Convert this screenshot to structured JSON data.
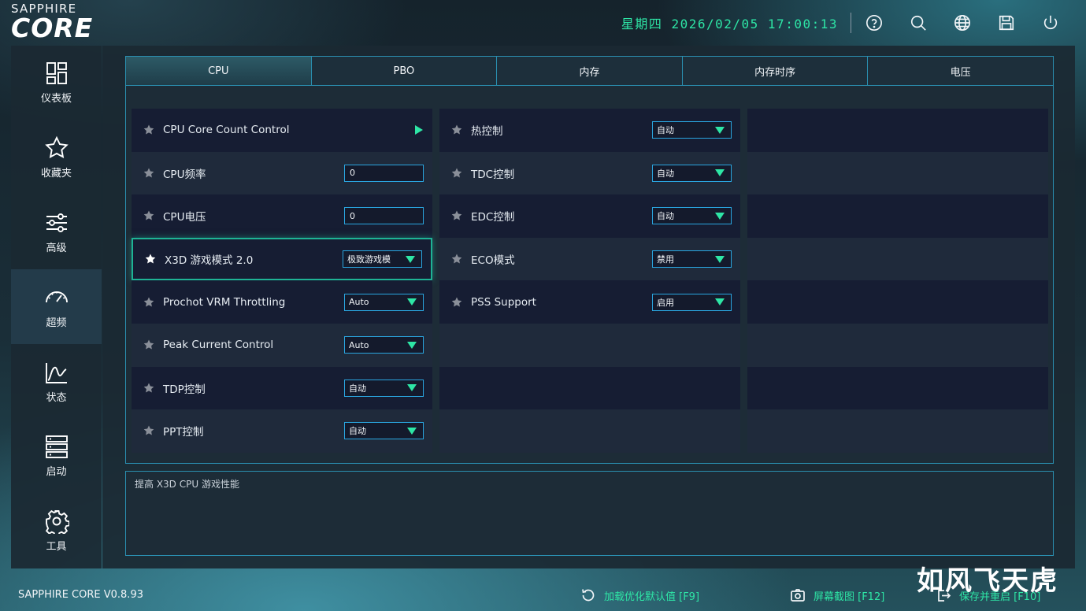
{
  "brand": {
    "top": "SAPPHIRE",
    "main": "CORE"
  },
  "header": {
    "datetime": "星期四 2026/02/05 17:00:13",
    "icons": [
      "help-icon",
      "search-icon",
      "globe-icon",
      "save-icon",
      "power-icon"
    ]
  },
  "sidebar": {
    "items": [
      {
        "label": "仪表板",
        "icon": "dashboard-icon"
      },
      {
        "label": "收藏夹",
        "icon": "star-icon"
      },
      {
        "label": "高级",
        "icon": "sliders-icon"
      },
      {
        "label": "超频",
        "icon": "gauge-icon",
        "active": true
      },
      {
        "label": "状态",
        "icon": "chart-icon"
      },
      {
        "label": "启动",
        "icon": "boot-icon"
      },
      {
        "label": "工具",
        "icon": "gear-icon"
      }
    ]
  },
  "tabs": [
    {
      "label": "CPU",
      "active": true
    },
    {
      "label": "PBO"
    },
    {
      "label": "内存"
    },
    {
      "label": "内存时序"
    },
    {
      "label": "电压"
    }
  ],
  "settings": {
    "col1": [
      {
        "label": "CPU Core Count Control",
        "type": "submenu"
      },
      {
        "label": "CPU频率",
        "type": "input",
        "value": "0"
      },
      {
        "label": "CPU电压",
        "type": "input",
        "value": "0"
      },
      {
        "label": "X3D 游戏模式 2.0",
        "type": "select",
        "value": "极致游戏模",
        "selected": true
      },
      {
        "label": "Prochot VRM Throttling",
        "type": "select",
        "value": "Auto"
      },
      {
        "label": "Peak Current Control",
        "type": "select",
        "value": "Auto"
      },
      {
        "label": "TDP控制",
        "type": "select",
        "value": "自动"
      },
      {
        "label": "PPT控制",
        "type": "select",
        "value": "自动"
      }
    ],
    "col2": [
      {
        "label": "热控制",
        "type": "select",
        "value": "自动"
      },
      {
        "label": "TDC控制",
        "type": "select",
        "value": "自动"
      },
      {
        "label": "EDC控制",
        "type": "select",
        "value": "自动"
      },
      {
        "label": "ECO模式",
        "type": "select",
        "value": "禁用"
      },
      {
        "label": "PSS Support",
        "type": "select",
        "value": "启用"
      }
    ]
  },
  "description": "提高 X3D CPU 游戏性能",
  "footer": {
    "version": "SAPPHIRE CORE V0.8.93",
    "load_defaults": "加载优化默认值 [F9]",
    "screenshot": "屏幕截图 [F12]",
    "save_restart": "保存并重启 [F10]"
  },
  "watermark": "如风飞天虎",
  "colors": {
    "accent": "#2ee6a6",
    "border": "#2a8fb0",
    "panel": "#1b2933"
  }
}
